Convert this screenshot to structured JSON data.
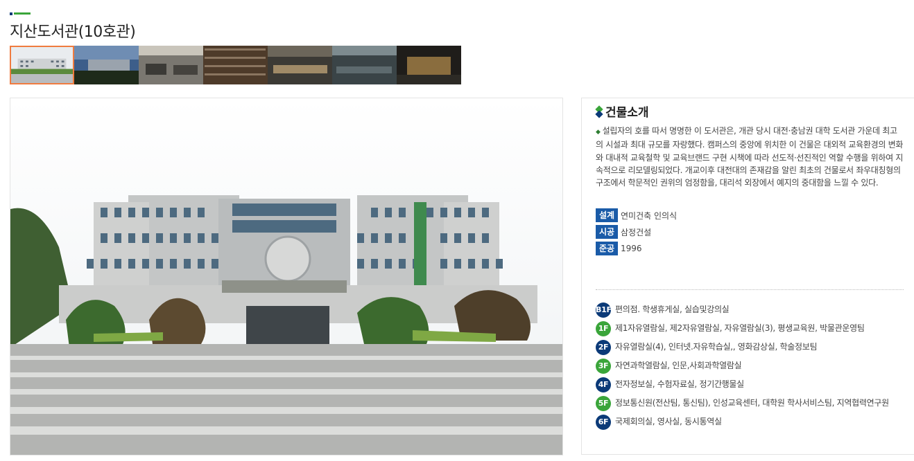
{
  "page": {
    "title": "지산도서관(10호관)"
  },
  "colors": {
    "accent_green": "#3aa53a",
    "accent_navy": "#0b3a78",
    "label_blue": "#1a5ba8",
    "thumb_selected_border": "#f07b3f"
  },
  "thumbnails": [
    {
      "name": "building-front"
    },
    {
      "name": "building-dusk"
    },
    {
      "name": "reading-room"
    },
    {
      "name": "bookshelves"
    },
    {
      "name": "study-hall"
    },
    {
      "name": "library-hall"
    },
    {
      "name": "building-night"
    }
  ],
  "info": {
    "section_title": "건물소개",
    "description": "설립자의 호를 따서 명명한 이 도서관은, 개관 당시 대전·충남권 대학 도서관 가운데 최고의 시설과 최대 규모를 자랑했다. 캠퍼스의 중앙에 위치한 이 건물은 대외적 교육환경의 변화와 대내적 교육철학 및 교육브랜드 구현 시책에 따라 선도적·선진적인 역할 수행을 위하여 지속적으로 리모델링되었다. 개교이후 대전대의 존재감을 알린 최초의 건물로서 좌우대칭형의 구조에서 학문적인 권위의 엄정함을, 대리석 외장에서 예지의 중대함을 느낄 수 있다.",
    "facts": [
      {
        "label": "설계",
        "value": "연미건축 인의식"
      },
      {
        "label": "시공",
        "value": "삼정건설"
      },
      {
        "label": "준공",
        "value": "1996"
      }
    ],
    "floors": [
      {
        "badge": "B1F",
        "color": "#0b3a78",
        "text": "편의점. 학생휴게실, 실습및강의실"
      },
      {
        "badge": "1F",
        "color": "#3aa53a",
        "text": "제1자유열람실, 제2자유열람실, 자유열람실(3), 평생교육원, 박물관운영팀"
      },
      {
        "badge": "2F",
        "color": "#0b3a78",
        "text": "자유열람실(4), 인터넷.자유학습실,, 영화감상실, 학술정보팀"
      },
      {
        "badge": "3F",
        "color": "#3aa53a",
        "text": "자연과학열람실, 인문,사회과학열람실"
      },
      {
        "badge": "4F",
        "color": "#0b3a78",
        "text": "전자정보실, 수험자료실, 정기간행물실"
      },
      {
        "badge": "5F",
        "color": "#3aa53a",
        "text": "정보통신원(전산팀, 통신팀), 인성교육센터, 대학원 학사서비스팀, 지역협력연구원"
      },
      {
        "badge": "6F",
        "color": "#0b3a78",
        "text": "국제회의실, 영사실, 동시통역실"
      }
    ]
  }
}
